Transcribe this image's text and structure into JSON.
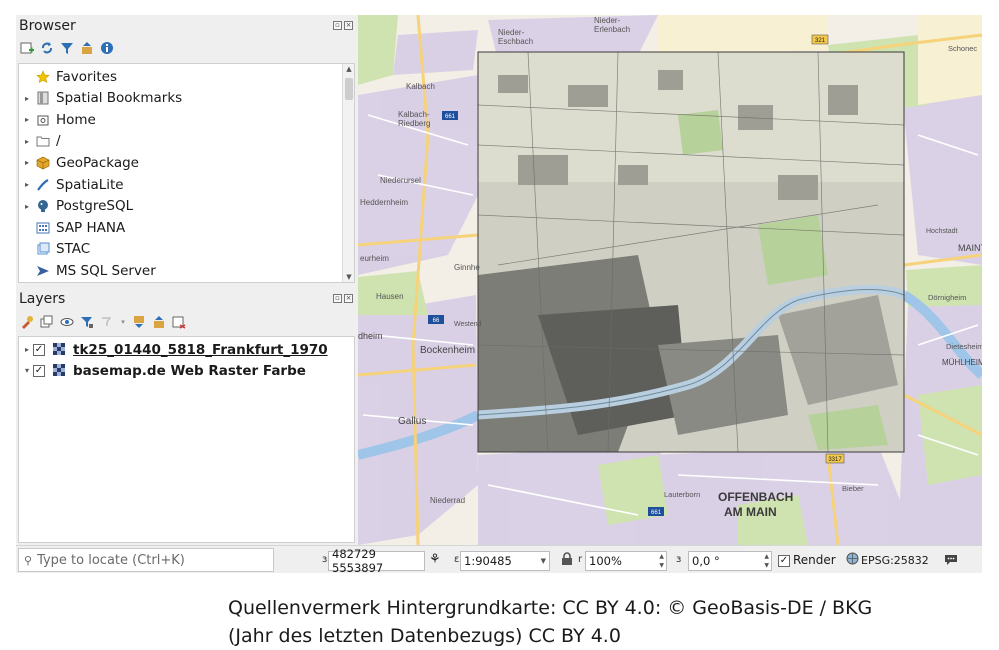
{
  "browser": {
    "title": "Browser",
    "items": [
      {
        "label": "Favorites",
        "icon": "star-icon",
        "expandable": false
      },
      {
        "label": "Spatial Bookmarks",
        "icon": "bookmark-icon",
        "expandable": true
      },
      {
        "label": "Home",
        "icon": "home-icon",
        "expandable": true
      },
      {
        "label": "/",
        "icon": "folder-icon",
        "expandable": true
      },
      {
        "label": "GeoPackage",
        "icon": "geopackage-icon",
        "expandable": true
      },
      {
        "label": "SpatiaLite",
        "icon": "spatialite-icon",
        "expandable": true
      },
      {
        "label": "PostgreSQL",
        "icon": "postgresql-icon",
        "expandable": true
      },
      {
        "label": "SAP HANA",
        "icon": "sap-hana-icon",
        "expandable": false
      },
      {
        "label": "STAC",
        "icon": "stac-icon",
        "expandable": false
      },
      {
        "label": "MS SQL Server",
        "icon": "mssql-icon",
        "expandable": false
      }
    ]
  },
  "layers": {
    "title": "Layers",
    "items": [
      {
        "label": "tk25_01440_5818_Frankfurt_1970",
        "checked": true,
        "underline": true
      },
      {
        "label": "basemap.de Web Raster Farbe",
        "checked": true,
        "underline": false
      }
    ]
  },
  "map": {
    "labels": {
      "nieder_eschbach": "Nieder-\nEschbach",
      "nieder_erlenbach": "Nieder-\nErlenbach",
      "schoneck": "Schonec",
      "kalbach": "Kalbach",
      "kalbach_riedberg": "Kalbach-\nRiedberg",
      "niederursel": "Niederursel",
      "heddernheim": "Heddernheim",
      "ginnheim": "Ginnhe",
      "eckenheim": "eurheim",
      "hausen": "Hausen",
      "westend": "Westend",
      "bockenheim": "Bockenheim",
      "rodelheim": "dheim",
      "gallus": "Gallus",
      "niederrad": "Niederrad",
      "hochstadt": "Hochstadt",
      "maintal": "MAINT",
      "dornigheim": "Dörnigheim",
      "dietesheim": "Dietesheim",
      "muhlheim": "MÜHLHEIM",
      "bieber": "Bieber",
      "lauterborn": "Lauterborn",
      "offenbach_1": "OFFENBACH",
      "offenbach_2": "AM MAIN"
    },
    "road_shields": [
      "661",
      "661",
      "66",
      "661",
      "321",
      "3317"
    ]
  },
  "statusbar": {
    "locator_placeholder": "Type to locate (Ctrl+K)",
    "coordinate": "482729  5553897",
    "scale": "1:90485",
    "magnifier": "100%",
    "rotation": "0,0 °",
    "render_label": "Render",
    "render_checked": true,
    "crs": "EPSG:25832",
    "coord_label": "ɜ",
    "scale_label": "ɛ",
    "magnifier_label": "r",
    "rotation_label": "ɜ"
  },
  "caption": {
    "line1": "Quellenvermerk Hintergrundkarte: CC BY 4.0: © GeoBasis-DE / BKG",
    "line2": "(Jahr des letzten Datenbezugs) CC BY 4.0"
  }
}
